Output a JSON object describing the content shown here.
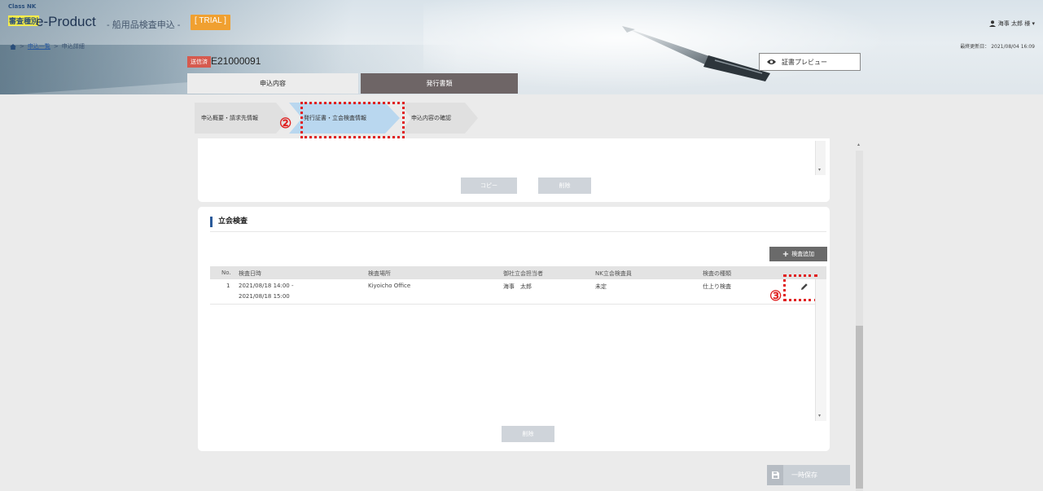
{
  "header": {
    "brand_small": "Class NK",
    "brand_badge": "審査種別",
    "app_title": "e-Product",
    "app_subtitle": "- 船用品検査申込 -",
    "trial_label": "[ TRIAL ]",
    "user_name": "海事 太郎 様 ▾",
    "last_updated": "最終更新日： 2021/08/04 16:09"
  },
  "breadcrumb": {
    "home_icon": "home-icon",
    "separator": ">",
    "list_link": "申込一覧",
    "current": "申込詳細"
  },
  "record": {
    "status": "送信済",
    "id": "E21000091",
    "preview_label": "証書プレビュー"
  },
  "tabs": [
    {
      "label": "申込内容",
      "active": true
    },
    {
      "label": "発行書類",
      "active": false
    }
  ],
  "steps": [
    {
      "label": "申込概要・請求先情報"
    },
    {
      "label": "発行証書・立会検査情報",
      "current": true
    },
    {
      "label": "申込内容の確認"
    }
  ],
  "annotations": {
    "step": "②",
    "edit": "③"
  },
  "top_panel": {
    "copy_label": "コピー",
    "delete_label": "削除"
  },
  "inspection": {
    "title": "立会検査",
    "add_label": "検査追加",
    "columns": [
      "No.",
      "検査日時",
      "検査場所",
      "御社立会担当者",
      "NK立会検査員",
      "検査の種類"
    ],
    "rows": [
      {
        "no": "1",
        "datetime_start": "2021/08/18 14:00 -",
        "datetime_end": "2021/08/18 15:00",
        "place": "Kiyoicho Office",
        "company_contact": "海事　太郎",
        "nk_inspector": "未定",
        "type": "仕上り検査"
      }
    ],
    "delete_label": "削除"
  },
  "footer": {
    "save_label": "一時保存"
  },
  "colors": {
    "accent_blue": "#2a5a9a",
    "trial": "#f0a030",
    "status": "#d65a4e",
    "annotation": "#e02020",
    "active_step": "#b9d7ef"
  }
}
